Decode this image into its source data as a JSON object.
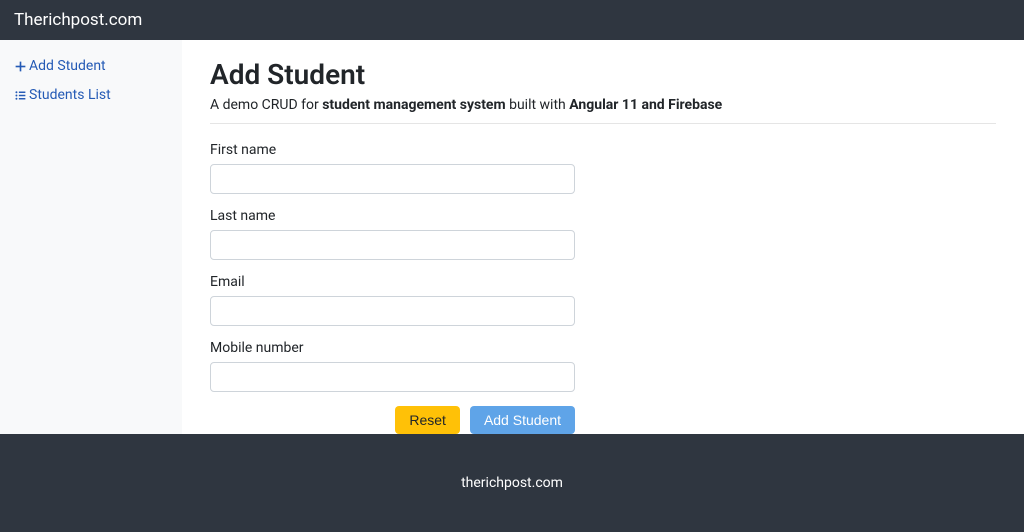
{
  "navbar": {
    "brand": "Therichpost.com"
  },
  "sidebar": {
    "items": [
      {
        "label": "Add Student"
      },
      {
        "label": "Students List"
      }
    ]
  },
  "page": {
    "title": "Add Student",
    "tagline_pre": "A demo CRUD for ",
    "tagline_strong1": "student management system",
    "tagline_mid": " built with ",
    "tagline_strong2": "Angular 11 and Firebase"
  },
  "form": {
    "firstName": {
      "label": "First name",
      "value": ""
    },
    "lastName": {
      "label": "Last name",
      "value": ""
    },
    "email": {
      "label": "Email",
      "value": ""
    },
    "mobile": {
      "label": "Mobile number",
      "value": ""
    },
    "reset_label": "Reset",
    "submit_label": "Add Student"
  },
  "footer": {
    "text": "therichpost.com"
  }
}
